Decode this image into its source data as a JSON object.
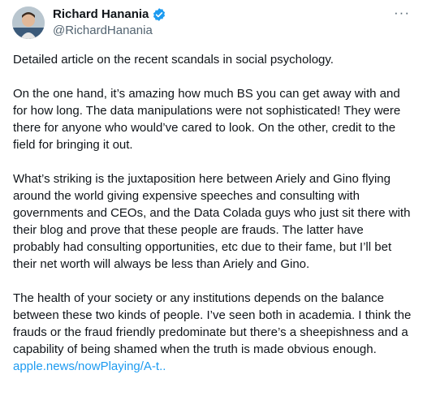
{
  "author": {
    "name": "Richard Hanania",
    "handle": "@RichardHanania",
    "verified": true
  },
  "menu_label": "···",
  "paragraphs": [
    "Detailed article on the recent scandals in social psychology.",
    "On the one hand, it’s amazing how much BS you can get away with and for how long. The data manipulations were not sophisticated! They were there for anyone who would’ve cared to look. On the other, credit to the field for bringing it out.",
    "What’s striking is the juxtaposition here between Ariely and Gino flying around the world giving expensive speeches and consulting with governments and CEOs, and the Data Colada guys who just sit there with their blog and prove that these people are frauds. The latter have probably had consulting opportunities, etc due to their fame, but I’ll bet their net worth will always be less than Ariely and Gino.",
    "The health of your society or any institutions depends on the balance between these two kinds of people. I’ve seen both in academia. I think the frauds or the fraud friendly predominate but there’s a sheepishness and a capability of being shamed when the truth is made obvious enough."
  ],
  "link_text": "apple.news/nowPlaying/A-t..",
  "colors": {
    "link": "#1d9bf0",
    "verified_badge": "#1d9bf0",
    "secondary_text": "#536471"
  },
  "icons": [
    "avatar",
    "verified-badge-icon",
    "more-options-icon"
  ]
}
